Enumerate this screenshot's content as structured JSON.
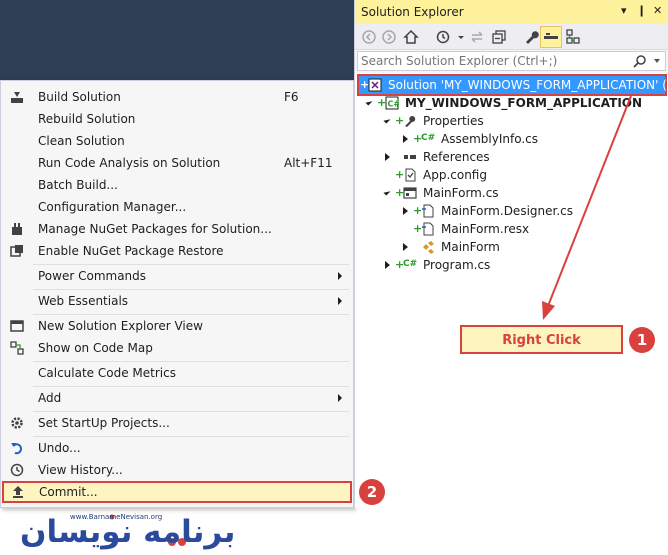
{
  "menu": {
    "items": [
      {
        "label": "Build Solution",
        "shortcut": "F6"
      },
      {
        "label": "Rebuild Solution",
        "shortcut": ""
      },
      {
        "label": "Clean Solution",
        "shortcut": ""
      },
      {
        "label": "Run Code Analysis on Solution",
        "shortcut": "Alt+F11"
      },
      {
        "label": "Batch Build...",
        "shortcut": ""
      },
      {
        "label": "Configuration Manager...",
        "shortcut": ""
      },
      {
        "label": "Manage NuGet Packages for Solution...",
        "shortcut": ""
      },
      {
        "label": "Enable NuGet Package Restore",
        "shortcut": ""
      },
      {
        "label": "Power Commands",
        "shortcut": ""
      },
      {
        "label": "Web Essentials",
        "shortcut": ""
      },
      {
        "label": "New Solution Explorer View",
        "shortcut": ""
      },
      {
        "label": "Show on Code Map",
        "shortcut": ""
      },
      {
        "label": "Calculate Code Metrics",
        "shortcut": ""
      },
      {
        "label": "Add",
        "shortcut": ""
      },
      {
        "label": "Set StartUp Projects...",
        "shortcut": ""
      },
      {
        "label": "Undo...",
        "shortcut": ""
      },
      {
        "label": "View History...",
        "shortcut": ""
      },
      {
        "label": "Commit...",
        "shortcut": ""
      }
    ]
  },
  "solution_explorer": {
    "title": "Solution Explorer",
    "pin_label": "↓ ⨅ ×",
    "search_placeholder": "Search Solution Explorer (Ctrl+;)",
    "tree": [
      {
        "label": "Solution 'MY_WINDOWS_FORM_APPLICATION' (1 pr"
      },
      {
        "label": "MY_WINDOWS_FORM_APPLICATION"
      },
      {
        "label": "Properties"
      },
      {
        "label": "AssemblyInfo.cs"
      },
      {
        "label": "References"
      },
      {
        "label": "App.config"
      },
      {
        "label": "MainForm.cs"
      },
      {
        "label": "MainForm.Designer.cs"
      },
      {
        "label": "MainForm.resx"
      },
      {
        "label": "MainForm"
      },
      {
        "label": "Program.cs"
      }
    ]
  },
  "annotations": {
    "right_click": "Right Click",
    "step1": "1",
    "step2": "2"
  },
  "logo": {
    "url": "www.BarnameNevisan.org",
    "text": "برنامه نویسان"
  },
  "colors": {
    "accent_red": "#d9413e",
    "highlight_yellow": "#fdf4bf",
    "selection_blue": "#3399ff",
    "title_yellow": "#fff29d"
  }
}
